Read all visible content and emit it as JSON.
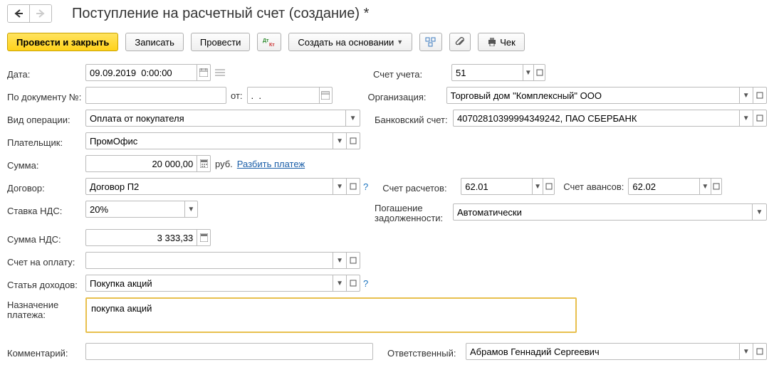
{
  "title": "Поступление на расчетный счет (создание) *",
  "toolbar": {
    "post_close": "Провести и закрыть",
    "save": "Записать",
    "post": "Провести",
    "create_based": "Создать на основании",
    "check": "Чек"
  },
  "labels": {
    "date": "Дата:",
    "doc_num": "По документу №:",
    "from": "от:",
    "operation": "Вид операции:",
    "payer": "Плательщик:",
    "amount": "Сумма:",
    "currency": "руб.",
    "split": "Разбить платеж",
    "contract": "Договор:",
    "vat_rate": "Ставка НДС:",
    "vat_sum": "Сумма НДС:",
    "invoice": "Счет на оплату:",
    "income_item": "Статья доходов:",
    "purpose": "Назначение платежа:",
    "comment": "Комментарий:",
    "account": "Счет учета:",
    "org": "Организация:",
    "bank_acc": "Банковский счет:",
    "settle_acc": "Счет расчетов:",
    "advance_acc": "Счет авансов:",
    "debt": "Погашение задолженности:",
    "responsible": "Ответственный:"
  },
  "values": {
    "date": "09.09.2019  0:00:00",
    "doc_num": "",
    "doc_from": ".  .",
    "operation": "Оплата от покупателя",
    "payer": "ПромОфис",
    "amount": "20 000,00",
    "contract": "Договор П2",
    "vat_rate": "20%",
    "vat_sum": "3 333,33",
    "invoice": "",
    "income_item": "Покупка акций",
    "purpose": "покупка акций",
    "comment": "",
    "account": "51",
    "org": "Торговый дом \"Комплексный\" ООО",
    "bank_acc": "40702810399994349242, ПАО СБЕРБАНК",
    "settle_acc": "62.01",
    "advance_acc": "62.02",
    "debt": "Автоматически",
    "responsible": "Абрамов Геннадий Сергеевич"
  }
}
